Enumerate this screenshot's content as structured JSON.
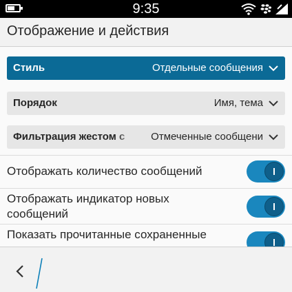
{
  "status_bar": {
    "time": "9:35",
    "icons": [
      "battery-icon",
      "wifi-icon",
      "blackberry-icon",
      "signal-icon"
    ]
  },
  "header": {
    "title": "Отображение и действия"
  },
  "dropdowns": [
    {
      "label": "Стиль",
      "value": "Отдельные сообщения",
      "active": true
    },
    {
      "label": "Порядок",
      "value": "Имя, тема",
      "active": false
    },
    {
      "label": "Фильтрация жестом с",
      "value": "Отмеченные сообщени",
      "active": false
    }
  ],
  "toggles": [
    {
      "label": "Отображать количество сообщений",
      "on": true
    },
    {
      "label": "Отображать индикатор новых сообщений",
      "on": true
    },
    {
      "label": "Показать прочитанные сохраненные",
      "on": true
    }
  ],
  "bottom_bar": {
    "back_icon": "chevron-left-icon"
  },
  "colors": {
    "accent": "#0b6a96",
    "toggle_on": "#1a87be",
    "background": "#f2f2f2"
  }
}
